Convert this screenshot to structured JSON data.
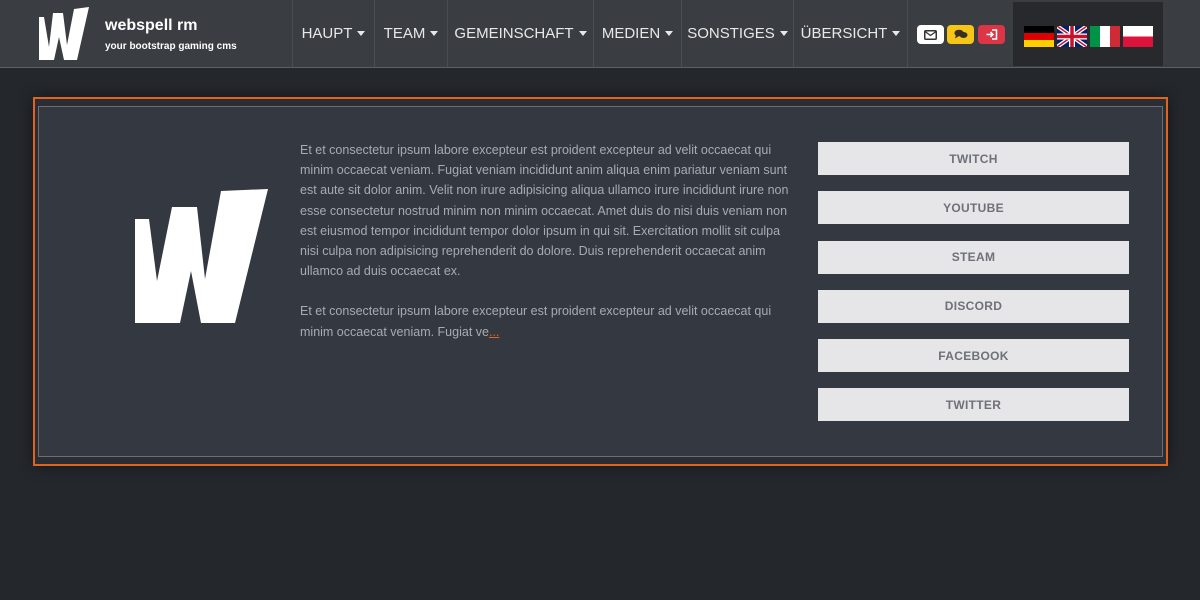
{
  "brand": {
    "title": "webspell rm",
    "subtitle": "your bootstrap gaming cms",
    "logo_icon": "w-logo-icon"
  },
  "nav": {
    "items": [
      {
        "label": "HAUPT"
      },
      {
        "label": "TEAM"
      },
      {
        "label": "GEMEINSCHAFT"
      },
      {
        "label": "MEDIEN"
      },
      {
        "label": "SONSTIGES"
      },
      {
        "label": "ÜBERSICHT"
      }
    ],
    "icon_buttons": [
      {
        "icon": "envelope-icon",
        "color": "#ffffff"
      },
      {
        "icon": "chat-icon",
        "color": "#f5c518"
      },
      {
        "icon": "sign-in-icon",
        "color": "#dc3545"
      }
    ],
    "flags": [
      "flag-de",
      "flag-gb",
      "flag-it",
      "flag-pl"
    ]
  },
  "content": {
    "paragraphs": [
      "Et et consectetur ipsum labore excepteur est proident excepteur ad velit occaecat qui minim occaecat veniam. Fugiat veniam incididunt anim aliqua enim pariatur veniam sunt est aute sit dolor anim. Velit non irure adipisicing aliqua ullamco irure incididunt irure non esse consectetur nostrud minim non minim occaecat. Amet duis do nisi duis veniam non est eiusmod tempor incididunt tempor dolor ipsum in qui sit. Exercitation mollit sit culpa nisi culpa non adipisicing reprehenderit do dolore. Duis reprehenderit occaecat anim ullamco ad duis occaecat ex.",
      "Et et consectetur ipsum labore excepteur est proident excepteur ad velit occaecat qui minim occaecat veniam. Fugiat ve"
    ],
    "readmore": "...",
    "social": [
      "TWITCH",
      "YOUTUBE",
      "STEAM",
      "DISCORD",
      "FACEBOOK",
      "TWITTER"
    ]
  },
  "colors": {
    "accent": "#e0641c",
    "navbar": "#3a3d42",
    "background": "#24272c"
  }
}
